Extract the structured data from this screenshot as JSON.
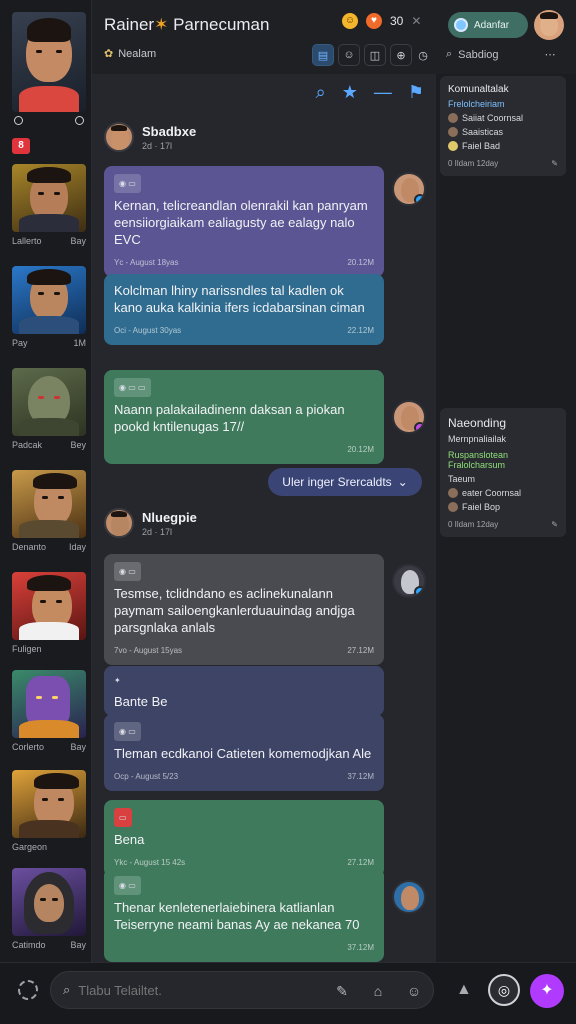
{
  "header": {
    "title": "Rainer",
    "title_suffix": "Parnecuman",
    "subtitle": "Nealam",
    "count": "30",
    "advance_label": "Adanfar"
  },
  "left_rooms": [
    {
      "name": "Lallerto",
      "meta": "Bay"
    },
    {
      "name": "Pay",
      "meta": "1M"
    },
    {
      "name": "Padcak",
      "meta": "Bey"
    },
    {
      "name": "Denanto",
      "meta": "Iday"
    },
    {
      "name": "Fuligen",
      "meta": ""
    },
    {
      "name": "Corlerto",
      "meta": "Bay"
    },
    {
      "name": "Gargeon",
      "meta": ""
    },
    {
      "name": "Catimdo",
      "meta": "Bay"
    }
  ],
  "chat": {
    "sender1": {
      "name": "Sbadbxe",
      "time": "2d · 17l"
    },
    "sender2": {
      "name": "Nluegpie",
      "time": "2d · 17l"
    },
    "jump_label": "Uler inger Srercaldts",
    "messages": [
      {
        "text": "Kernan, telicreandlan olenrakil kan panryam eensiiorgiaikam ealiagusty ae ealagy nalo EVC",
        "foot_left": "Yc - August 18yas",
        "foot_right": "20.12M"
      },
      {
        "text": "Kolclman lhiny narissndles tal kadlen ok kano auka kalkinia ifers icdabarsinan ciman",
        "foot_left": "Oci - August 30yas",
        "foot_right": "22.12M"
      },
      {
        "text": "Naann palakailadinenn daksan a piokan pookd kntilenugas 17//",
        "foot_left": "",
        "foot_right": "20.12M"
      },
      {
        "text": "Tesmse, tclidndano es aclinekunalann paymam sailoengkanlerduauindag andjga parsgnlaka anlals",
        "foot_left": "7vo - August 15yas",
        "foot_right": "27.12M"
      },
      {
        "text": "Bante Be",
        "foot_left": "",
        "foot_right": ""
      },
      {
        "text": "Tleman ecdkanoi Catieten komemodjkan Ale",
        "foot_left": "Ocp - August 5/23",
        "foot_right": "37.12M"
      },
      {
        "text": "Bena",
        "foot_left": "Ykc - August 15 42s",
        "foot_right": "27.12M"
      },
      {
        "text": "Thenar kenletenerlaiebinera katlianlan Teiserryne neami banas Ay ae nekanea 70",
        "foot_left": "",
        "foot_right": "37.12M"
      }
    ]
  },
  "right_panel": {
    "search_label": "Sabdiog",
    "card1": {
      "title": "Komunaltalak",
      "highlight": "Frelolcheiriam",
      "rows": [
        "Saiiat Coornsal",
        "Saaisticas",
        "Faiel Bad"
      ],
      "meta_left": "0 Ildam 12day"
    },
    "card2": {
      "title": "Naeonding",
      "subtitle": "Mernpnaliailak",
      "hl_a": "Ruspanslotean",
      "hl_b": "Fralolcharsum",
      "rows": [
        "Taeum",
        "eater Coornsal",
        "Faiel Bop"
      ],
      "meta_left": "0 Ildam 12day"
    }
  },
  "bottom": {
    "input_placeholder": "Tlabu Telailtet."
  }
}
